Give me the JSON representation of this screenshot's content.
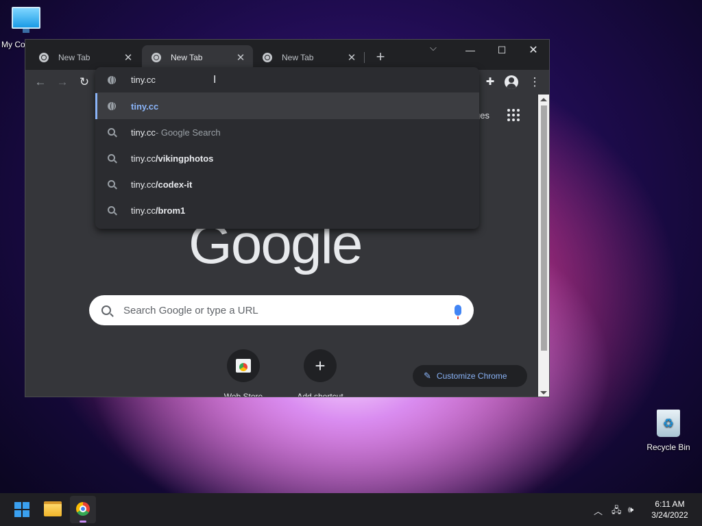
{
  "desktop": {
    "my_computer_label": "My Co",
    "recycle_bin_label": "Recycle Bin"
  },
  "browser": {
    "tabs": [
      {
        "title": "New Tab",
        "active": false
      },
      {
        "title": "New Tab",
        "active": true
      },
      {
        "title": "New Tab",
        "active": false
      }
    ],
    "new_tab_symbol": "+",
    "omnibox": {
      "value": "tiny.cc",
      "suggestions": [
        {
          "type": "url",
          "text": "tiny.cc",
          "suffix": "",
          "selected": true
        },
        {
          "type": "search",
          "text": "tiny.cc",
          "suffix": " - Google Search",
          "selected": false
        },
        {
          "type": "search",
          "text": "tiny.cc",
          "suffix": "/vikingphotos",
          "selected": false
        },
        {
          "type": "search",
          "text": "tiny.cc",
          "suffix": "/codex-it",
          "selected": false
        },
        {
          "type": "search",
          "text": "tiny.cc",
          "suffix": "/brom1",
          "selected": false
        }
      ]
    },
    "ntp": {
      "logo_text": "Google",
      "images_link_partial": "ges",
      "search_placeholder": "Search Google or type a URL",
      "shortcuts": [
        {
          "label": "Web Store"
        },
        {
          "label": "Add shortcut"
        }
      ],
      "customize_label": "Customize Chrome"
    }
  },
  "taskbar": {
    "time": "6:11 AM",
    "date": "3/24/2022"
  },
  "colors": {
    "accent_blue": "#8ab4f8",
    "chrome_dark": "#35363a",
    "tabstrip": "#202124"
  }
}
